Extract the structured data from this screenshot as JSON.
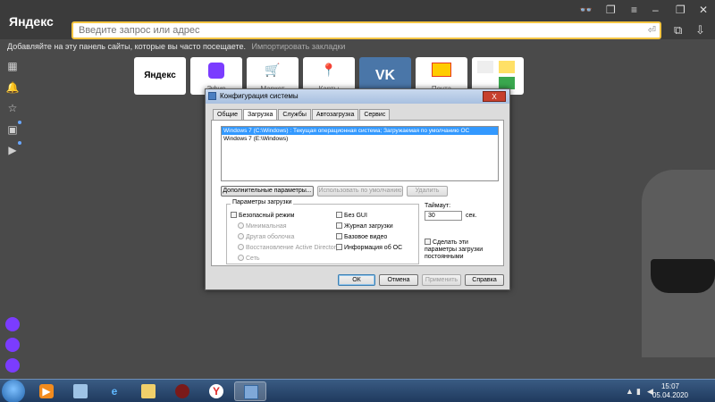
{
  "browser": {
    "brand": "Яндекс",
    "search_placeholder": "Введите запрос или адрес",
    "bookmarks_hint": "Добавляйте на эту панель сайты, которые вы часто посещаете.",
    "import_bookmarks": "Импортировать закладки"
  },
  "tiles": [
    {
      "label": "Яндекс"
    },
    {
      "label": "Эфир"
    },
    {
      "label": "Маркет"
    },
    {
      "label": "Карты"
    },
    {
      "label": "VK"
    },
    {
      "label": "Почта"
    }
  ],
  "dialog": {
    "title": "Конфигурация системы",
    "close": "X",
    "tabs": [
      {
        "label": "Общие"
      },
      {
        "label": "Загрузка"
      },
      {
        "label": "Службы"
      },
      {
        "label": "Автозагрузка"
      },
      {
        "label": "Сервис"
      }
    ],
    "os_list": [
      "Windows 7 (C:\\Windows) : Текущая операционная система; Загружаемая по умолчанию ОС",
      "Windows 7 (E:\\Windows)"
    ],
    "btn_advanced": "Дополнительные параметры...",
    "btn_default": "Использовать по умолчанию",
    "btn_delete": "Удалить",
    "group_title": "Параметры загрузки",
    "safe_boot": "Безопасный режим",
    "radio_minimal": "Минимальная",
    "radio_shell": "Другая оболочка",
    "radio_ad": "Восстановление Active Directory",
    "radio_network": "Сеть",
    "no_gui": "Без GUI",
    "boot_log": "Журнал загрузки",
    "base_video": "Базовое видео",
    "os_info": "Информация  об ОС",
    "timeout_label": "Таймаут:",
    "timeout_value": "30",
    "timeout_unit": "сек.",
    "make_permanent": "Сделать эти параметры загрузки постоянными",
    "ok": "ОК",
    "cancel": "Отмена",
    "apply": "Применить",
    "help": "Справка"
  },
  "taskbar": {
    "time": "15:07",
    "date": "05.04.2020"
  }
}
